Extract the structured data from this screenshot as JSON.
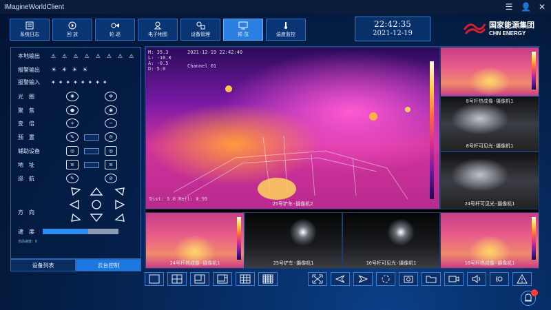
{
  "app": {
    "title": "IMagineWorldClient"
  },
  "window": {
    "icons": [
      "menu-icon",
      "person-icon",
      "close-icon"
    ]
  },
  "toolbar": {
    "buttons": [
      {
        "label": "系统日志",
        "icon": "log-icon"
      },
      {
        "label": "回 放",
        "icon": "playback-icon"
      },
      {
        "label": "轮 巡",
        "icon": "patrol-icon"
      },
      {
        "label": "电子地图",
        "icon": "map-icon"
      },
      {
        "label": "设备管理",
        "icon": "device-icon"
      },
      {
        "label": "预 览",
        "icon": "preview-icon",
        "active": true
      },
      {
        "label": "温度监控",
        "icon": "thermometer-icon"
      }
    ]
  },
  "clock": {
    "time": "22:42:35",
    "date": "2021-12-19"
  },
  "brand": {
    "name_cn": "国家能源集团",
    "name_en": "CHN ENERGY",
    "color": "#d81e2a"
  },
  "ptz": {
    "local_output": "本地输出",
    "alarm_output": "报警输出",
    "alarm_input": "报警输入",
    "iris": "光　圈",
    "focus": "聚　焦",
    "zoom": "变　倍",
    "preset": "预　置",
    "aux": "辅助设备",
    "address": "地　址",
    "cruise": "巡　航",
    "direction": "方　向",
    "speed": "速　度",
    "speed_level": 0.6,
    "speed_note": "当前速度：6"
  },
  "left_tabs": [
    {
      "label": "设备列表"
    },
    {
      "label": "云台控制",
      "active": true
    }
  ],
  "video": {
    "main_osd": [
      "M: 35.3",
      "L: -10.0",
      "A: -0.5",
      "D:  5.0"
    ],
    "main_timestamp": "2021-12-19 22:42:40",
    "main_channel": "Channel 01",
    "main_footer": "Dist: 5.0  Refl: 0.95",
    "main_caption": "25号铲车-摄像机2",
    "tiles": [
      {
        "caption": ""
      },
      {
        "caption": "8号杆热成像-摄像机1"
      },
      {
        "caption": "8号杆可见光-摄像机1"
      },
      {
        "caption": "24号杆可见光-摄像机1"
      },
      {
        "caption": "24号杆热成像-摄像机1"
      },
      {
        "caption": "25号铲车-摄像机1"
      },
      {
        "caption": "16号杆可见光-摄像机1"
      },
      {
        "caption": "16号杆热成像-摄像机1"
      }
    ]
  },
  "layout_buttons": [
    "layout-1-icon",
    "layout-4-icon",
    "layout-6-icon",
    "layout-8-icon",
    "layout-9-icon",
    "layout-16-icon"
  ],
  "action_buttons": [
    "fullscreen-icon",
    "prev-icon",
    "next-icon",
    "refresh-icon",
    "snapshot-icon",
    "folder-icon",
    "record-icon",
    "volume-icon",
    "talk-icon",
    "alarm-icon"
  ]
}
